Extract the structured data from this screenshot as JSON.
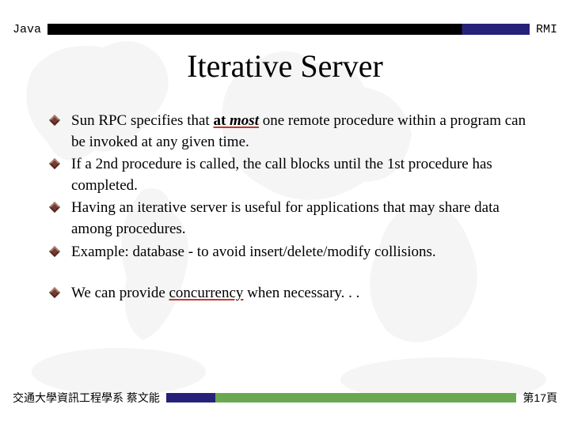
{
  "header": {
    "left": "Java",
    "right": "RMI"
  },
  "title": "Iterative Server",
  "bullets_group1": [
    {
      "pre": "Sun RPC specifies that ",
      "em1": "at ",
      "em2": "most",
      "post": " one remote procedure within a program can be invoked at any given time."
    },
    {
      "text": "If a 2nd procedure is called, the call blocks until the 1st procedure has completed."
    },
    {
      "text": "Having an iterative server is useful for applications that may share data among procedures."
    },
    {
      "text": "Example: database -  to avoid insert/delete/modify collisions."
    }
  ],
  "bullets_group2": [
    {
      "pre": "We can provide ",
      "em": "concurrency",
      "post": " when necessary. . ."
    }
  ],
  "footer": {
    "left": "交通大學資訊工程學系 蔡文能",
    "right": "第17頁"
  }
}
